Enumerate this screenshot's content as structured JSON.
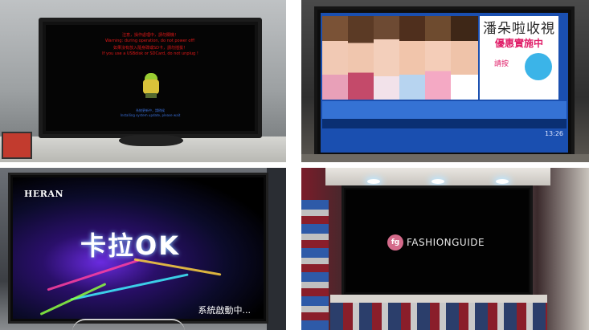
{
  "panels": [
    {
      "id": "panel-warning",
      "screen_lines": [
        "注意，操作處理中，請勿關機！",
        "Warning: during operation, do not power off!",
        "如果沒有放入隨身碟或SD卡，請勿插拔！",
        "If you use a USBdisk or SDCard, do not unplug !"
      ],
      "caption_lines": [
        "系統更新中，請稍候",
        "Installing system update, please wait"
      ]
    },
    {
      "id": "panel-tv-promo",
      "promo_title": "潘朵啦收視",
      "promo_subtitle": "優惠實施中",
      "promo_button": "請按",
      "clock": "13:26"
    },
    {
      "id": "panel-karaoke",
      "brand": "HERAN",
      "title": "卡拉OK",
      "status": "系統啟動中..."
    },
    {
      "id": "panel-fashion",
      "logo_mark": "fg",
      "logo_text": "FASHIONGUIDE"
    }
  ],
  "colors": {
    "warning_text": "#e01818",
    "promo_pink": "#e0206a",
    "screen_blue": "#1a4fb0",
    "logo_pink": "#d46a8a"
  }
}
